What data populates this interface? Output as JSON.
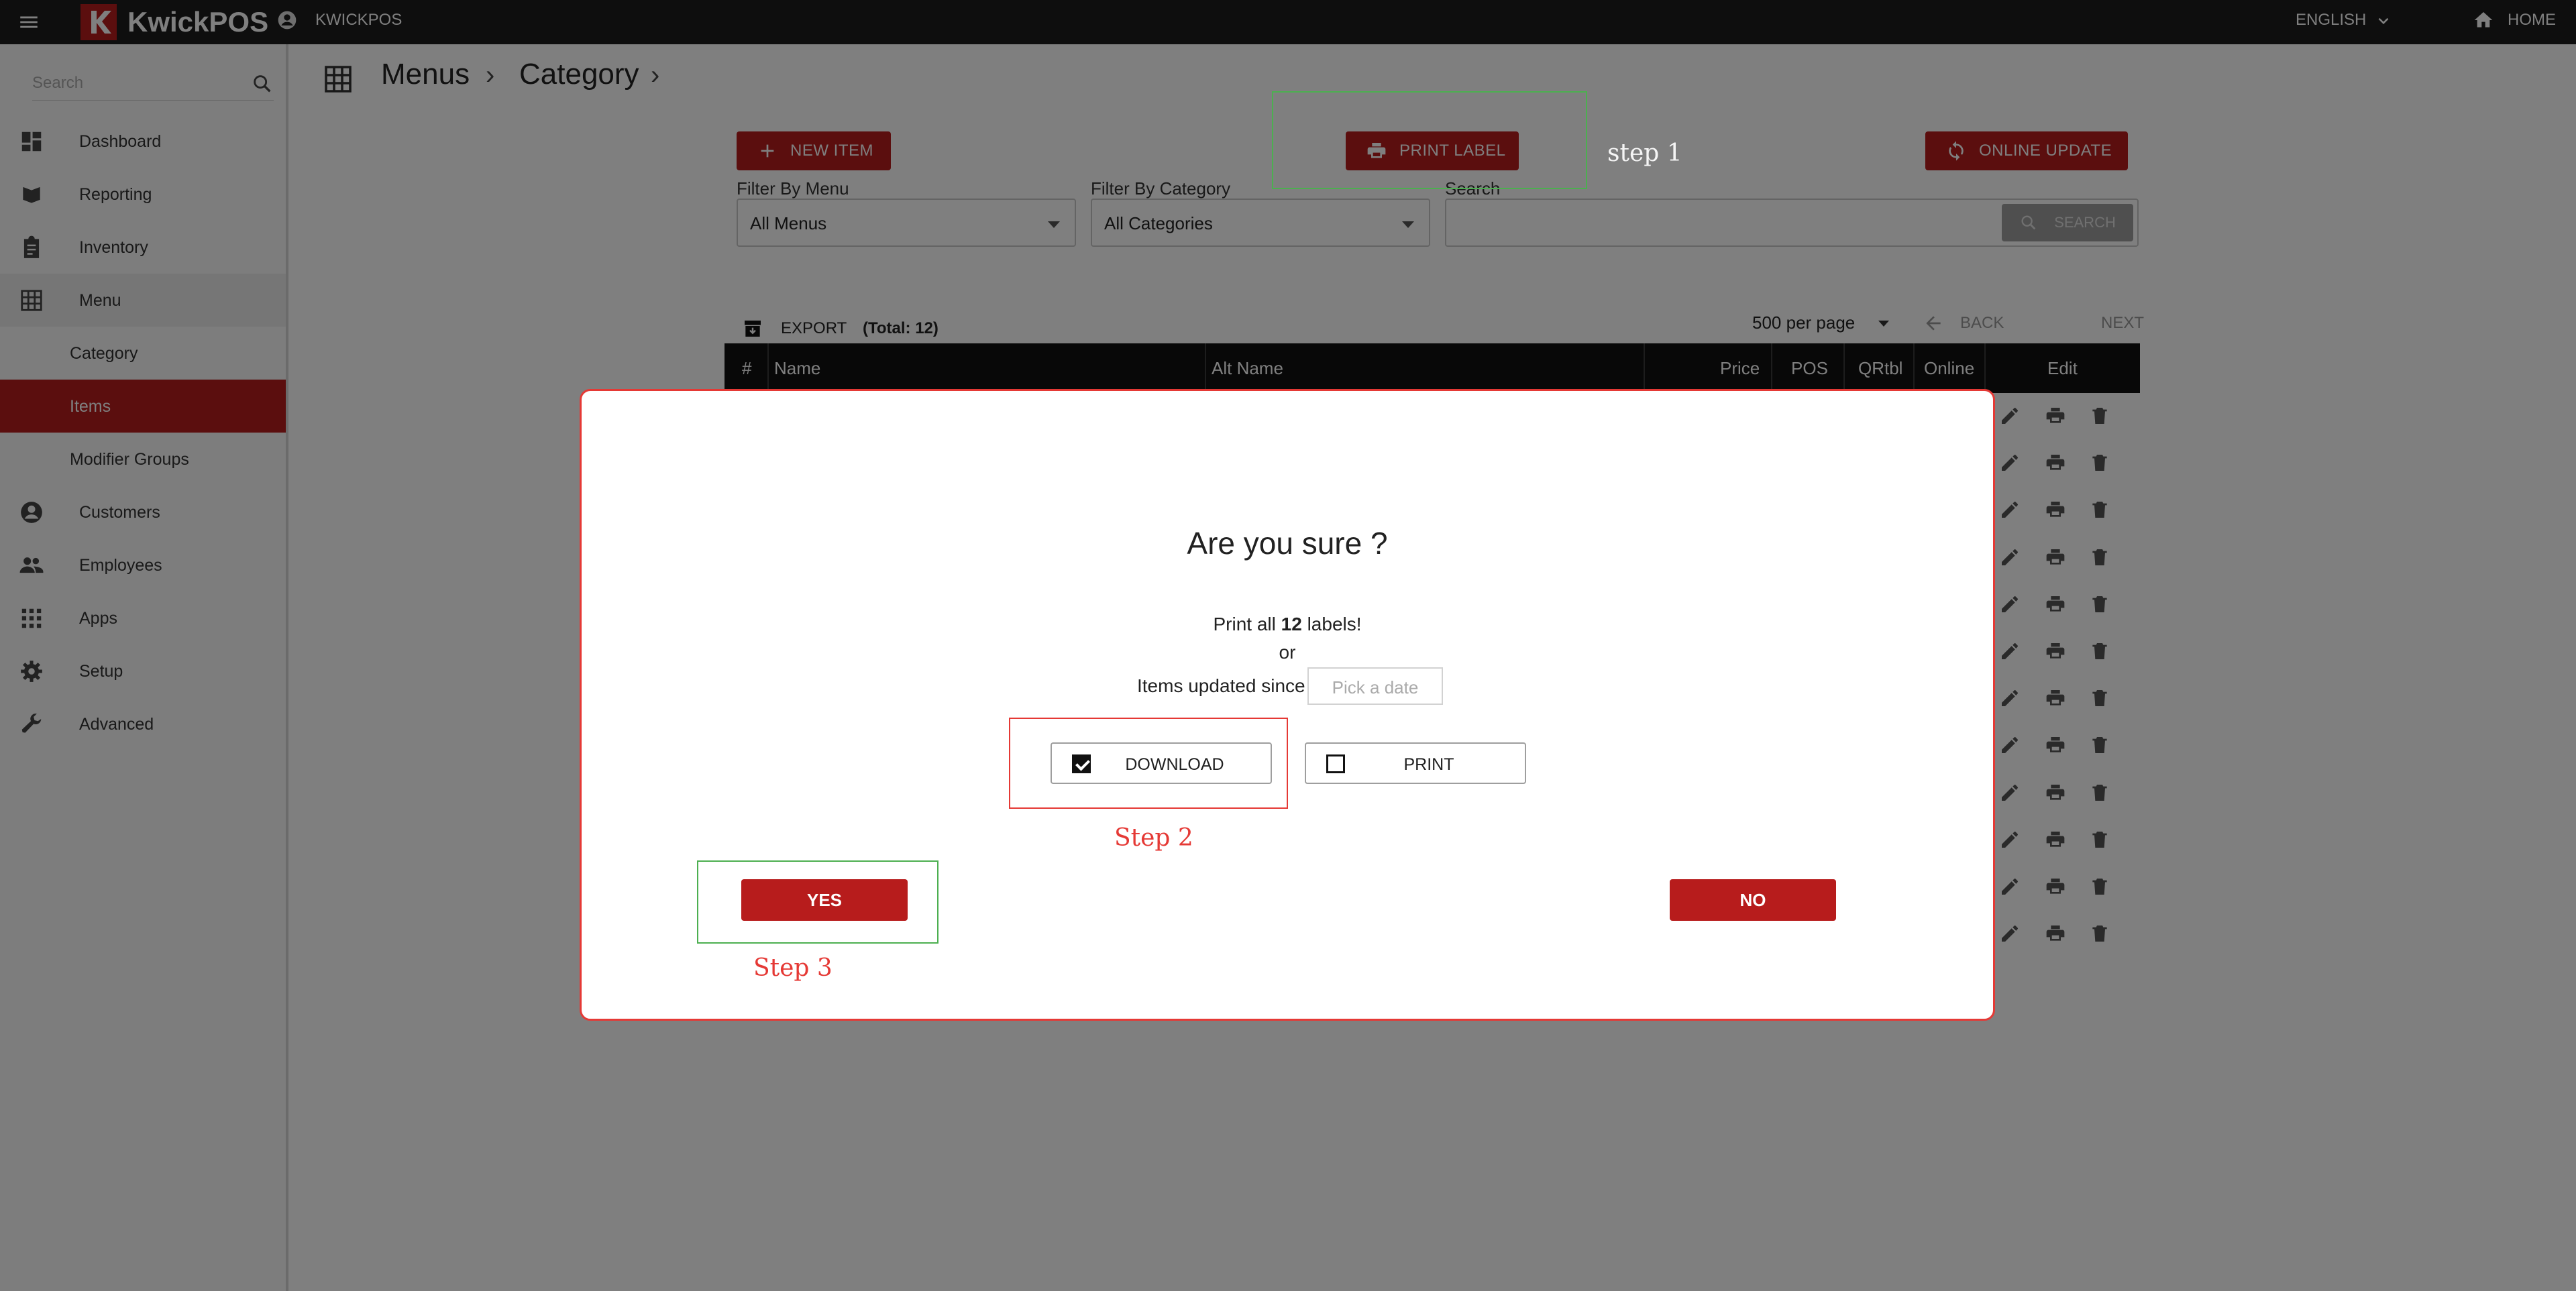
{
  "topbar": {
    "brand": "KwickPOS",
    "user_label": "KWICKPOS",
    "language": "ENGLISH",
    "home_label": "HOME"
  },
  "sidebar": {
    "search_placeholder": "Search",
    "items": [
      {
        "label": "Dashboard",
        "icon": "dashboard-icon"
      },
      {
        "label": "Reporting",
        "icon": "reporting-icon"
      },
      {
        "label": "Inventory",
        "icon": "clipboard-icon"
      },
      {
        "label": "Menu",
        "icon": "grid-icon"
      },
      {
        "label": "Category",
        "icon": ""
      },
      {
        "label": "Items",
        "icon": ""
      },
      {
        "label": "Modifier Groups",
        "icon": ""
      },
      {
        "label": "Customers",
        "icon": "account-circle-icon"
      },
      {
        "label": "Employees",
        "icon": "people-icon"
      },
      {
        "label": "Apps",
        "icon": "apps-icon"
      },
      {
        "label": "Setup",
        "icon": "gear-icon"
      },
      {
        "label": "Advanced",
        "icon": "wrench-icon"
      }
    ]
  },
  "breadcrumb": {
    "items": [
      "Menus",
      "Category"
    ],
    "separator": "›"
  },
  "toolbar": {
    "new_item": "NEW ITEM",
    "print_label": "PRINT LABEL",
    "online_update": "ONLINE UPDATE"
  },
  "filters": {
    "menu_label": "Filter By Menu",
    "menu_value": "All Menus",
    "category_label": "Filter By Category",
    "category_value": "All Categories",
    "search_label": "Search",
    "search_button": "SEARCH"
  },
  "table": {
    "export": "EXPORT",
    "total": "(Total: 12)",
    "per_page": "500 per page",
    "back": "BACK",
    "next": "NEXT",
    "columns": [
      "#",
      "Name",
      "Alt Name",
      "Price",
      "POS",
      "QRtbl",
      "Online",
      "Edit"
    ]
  },
  "modal": {
    "title": "Are you sure ?",
    "print_all_prefix": "Print all",
    "count": "12",
    "print_all_suffix": "labels!",
    "or": "or",
    "updated_since": "Items updated since",
    "date_placeholder": "Pick a date",
    "download": "DOWNLOAD",
    "print": "PRINT",
    "download_checked": true,
    "print_checked": false,
    "yes": "YES",
    "no": "NO"
  },
  "annotations": {
    "step1": "step 1",
    "step2": "Step 2",
    "step3": "Step 3"
  },
  "colors": {
    "brand_red": "#b71c1c",
    "annotation_green": "#4caf50",
    "annotation_red": "#e53935"
  }
}
